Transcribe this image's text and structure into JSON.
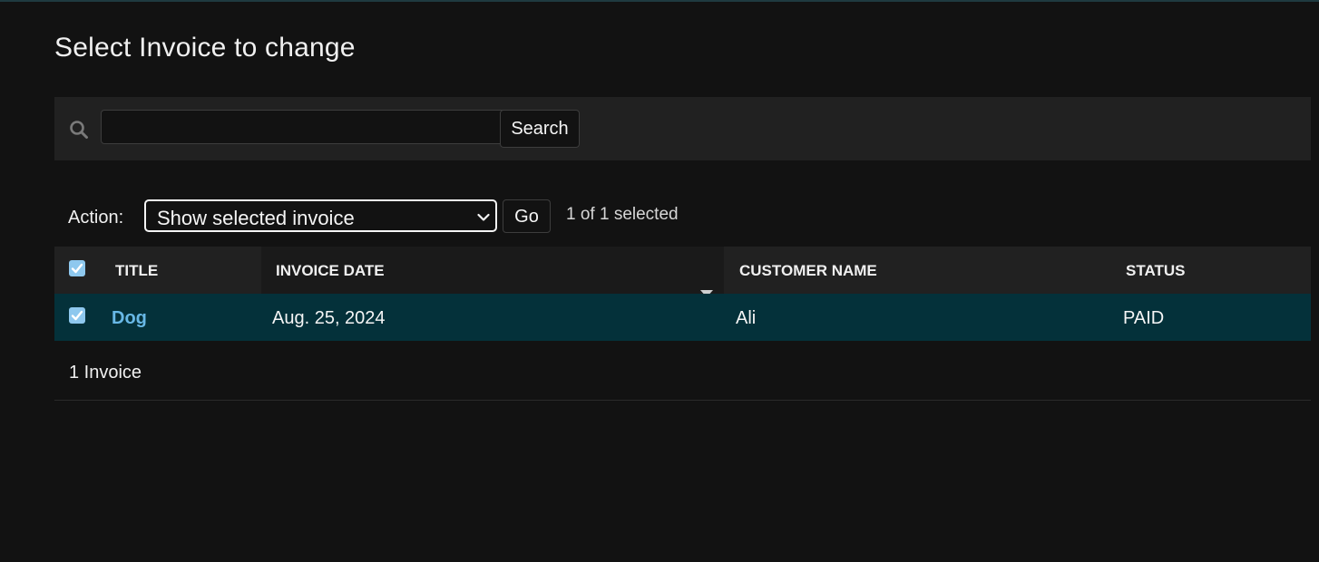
{
  "page": {
    "title": "Select Invoice to change"
  },
  "search": {
    "value": "",
    "button_label": "Search"
  },
  "actions": {
    "label": "Action:",
    "selected_action": "Show selected invoice",
    "go_label": "Go",
    "selection_counter": "1 of 1 selected"
  },
  "table": {
    "columns": {
      "title": "Title",
      "invoice_date": "Invoice date",
      "customer_name": "Customer name",
      "status": "Status"
    },
    "sorted_column": "invoice_date",
    "sort_direction": "descending",
    "rows": [
      {
        "selected": true,
        "title": "Dog",
        "invoice_date": "Aug. 25, 2024",
        "customer_name": "Ali",
        "status": "PAID"
      }
    ]
  },
  "paginator": {
    "text": "1 Invoice"
  },
  "colors": {
    "background": "#121212",
    "toolbar": "#212121",
    "selected_row": "#04313a",
    "link": "#68b8e6",
    "checkbox": "#8ec8ee"
  },
  "icons": {
    "search": "search-icon",
    "select_arrow": "chevron-down-icon",
    "sort": "sort-descending-icon",
    "checkbox": "checkbox-checked-icon"
  }
}
